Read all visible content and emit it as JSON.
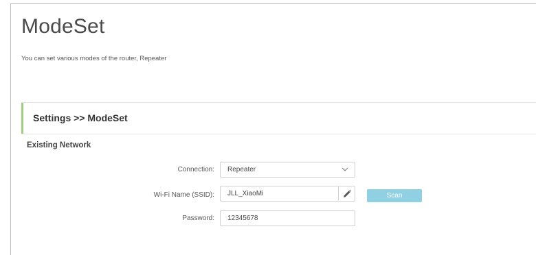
{
  "page": {
    "title": "ModeSet",
    "description": "You can set various modes of the router, Repeater"
  },
  "section": {
    "title": "Settings >> ModeSet"
  },
  "existing_network": {
    "title": "Existing Network",
    "connection": {
      "label": "Connection:",
      "value": "Repeater"
    },
    "ssid": {
      "label": "Wi-Fi Name (SSID):",
      "value": "JLL_XiaoMi"
    },
    "password": {
      "label": "Password:",
      "value": "12345678"
    },
    "scan_label": "Scan"
  },
  "colors": {
    "accent_bar": "#9bd17a",
    "scan_button": "#8fd0e3"
  },
  "icons": {
    "connection_dropdown": "chevron-down-icon",
    "ssid_edit": "pencil-icon"
  }
}
